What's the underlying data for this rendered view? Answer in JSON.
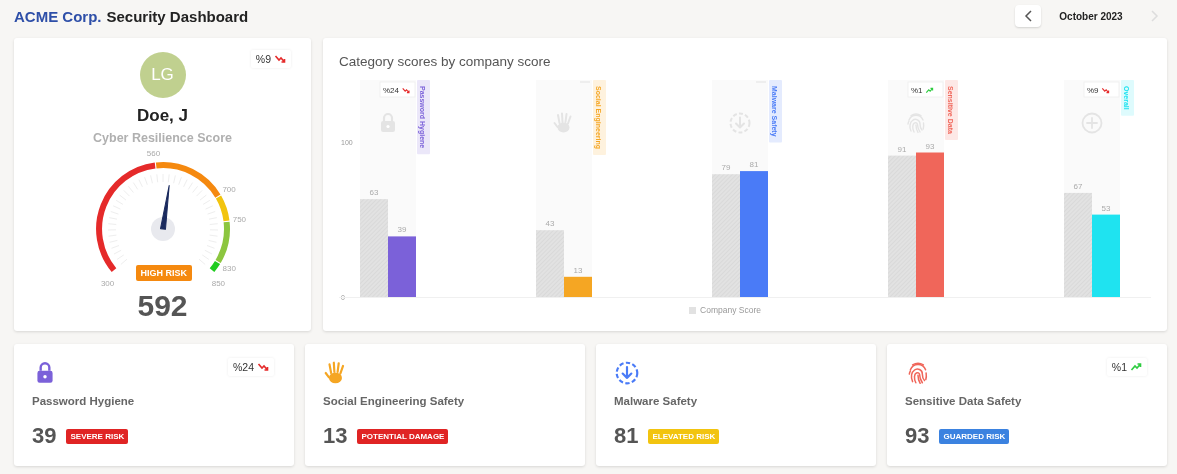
{
  "header": {
    "brand": "ACME Corp.",
    "title": "Security Dashboard",
    "period": "October 2023",
    "prev": {
      "disabled": false
    },
    "next": {
      "disabled": true
    }
  },
  "score_card": {
    "initials": "LG",
    "name": "Doe, J",
    "subtitle": "Cyber Resilience Score",
    "change": {
      "text": "%9",
      "kind": "down"
    },
    "gauge": {
      "start_label": "300",
      "level": 0.531,
      "segments": [
        {
          "label": "560",
          "color": "#e52a2a"
        },
        {
          "label": "700",
          "color": "#f5890f"
        },
        {
          "label": "750",
          "color": "#f2c40f"
        },
        {
          "label": "830",
          "color": "#8cc63f"
        },
        {
          "label": "850",
          "color": "#1fcc1f"
        }
      ]
    },
    "risk": {
      "text": "HIGH RISK"
    },
    "score": "592"
  },
  "chart": {
    "title": "Category scores by company score",
    "chart_data": {
      "type": "bar",
      "categories": [
        "Password Hygiene",
        "Social Engineering",
        "Malware Safety",
        "Sensitive Data",
        "Overall"
      ],
      "ylim": [
        0,
        167
      ],
      "yticks": [
        0,
        100
      ],
      "data_labels": true,
      "series": [
        {
          "name": "Company Score",
          "color": "#e2e2e2",
          "values": [
            63,
            43,
            79,
            91,
            67
          ]
        },
        {
          "colors": [
            "#7b61d9",
            "#f5a623",
            "#4a7bf7",
            "#f0665a",
            "#1fe3f0"
          ],
          "values": [
            39,
            13,
            81,
            93,
            53
          ]
        }
      ]
    },
    "changes": [
      {
        "text": "%24",
        "kind": "down"
      },
      {
        "kind": "empty"
      },
      {
        "kind": "empty"
      },
      {
        "text": "%1",
        "kind": "up"
      },
      {
        "text": "%9",
        "kind": "down"
      }
    ]
  },
  "cards": [
    {
      "title": "Password Hygiene",
      "color": "#7b61d9",
      "score": "39",
      "risk": {
        "text": "SEVERE RISK",
        "color": "#e02424"
      },
      "change": {
        "text": "%24",
        "kind": "down"
      }
    },
    {
      "title": "Social Engineering Safety",
      "color": "#f5a623",
      "score": "13",
      "risk": {
        "text": "POTENTIAL DAMAGE",
        "color": "#e02424"
      }
    },
    {
      "title": "Malware Safety",
      "color": "#4a7bf7",
      "score": "81",
      "risk": {
        "text": "ELEVATED RISK",
        "color": "#f2c40f"
      }
    },
    {
      "title": "Sensitive Data Safety",
      "color": "#f0665a",
      "score": "93",
      "risk": {
        "text": "GUARDED RISK",
        "color": "#3b82e0"
      },
      "change": {
        "text": "%1",
        "kind": "up"
      }
    }
  ]
}
